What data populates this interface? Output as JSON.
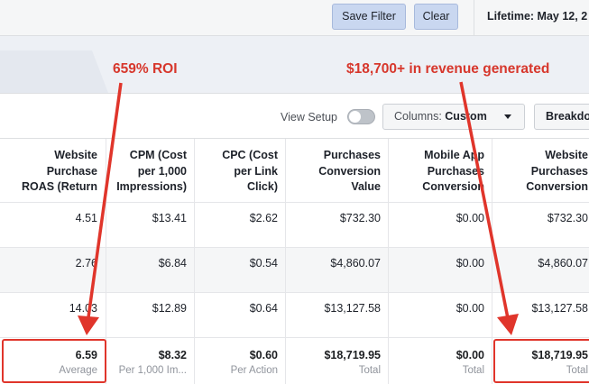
{
  "topbar": {
    "save_filter": "Save Filter",
    "clear": "Clear",
    "lifetime": "Lifetime: May 12, 2"
  },
  "annotations": {
    "roi": "659% ROI",
    "revenue": "$18,700+ in revenue generated",
    "color": "#d7372c"
  },
  "toolbar": {
    "view_setup": "View Setup",
    "columns_prefix": "Columns: ",
    "columns_value": "Custom",
    "breakdown": "Breakdo"
  },
  "table": {
    "headers": [
      [
        "Website",
        "Purchase",
        "ROAS (Return"
      ],
      [
        "CPM (Cost",
        "per 1,000",
        "Impressions)"
      ],
      [
        "CPC (Cost",
        "per Link",
        "Click)"
      ],
      [
        "Purchases",
        "Conversion",
        "Value"
      ],
      [
        "Mobile App",
        "Purchases",
        "Conversion"
      ],
      [
        "Website",
        "Purchases",
        "Conversion"
      ]
    ],
    "rows": [
      [
        "4.51",
        "$13.41",
        "$2.62",
        "$732.30",
        "$0.00",
        "$732.30"
      ],
      [
        "2.76",
        "$6.84",
        "$0.54",
        "$4,860.07",
        "$0.00",
        "$4,860.07"
      ],
      [
        "14.03",
        "$12.89",
        "$0.64",
        "$13,127.58",
        "$0.00",
        "$13,127.58"
      ]
    ],
    "totals": [
      {
        "value": "6.59",
        "label": "Average"
      },
      {
        "value": "$8.32",
        "label": "Per 1,000 Im..."
      },
      {
        "value": "$0.60",
        "label": "Per Action"
      },
      {
        "value": "$18,719.95",
        "label": "Total"
      },
      {
        "value": "$0.00",
        "label": "Total"
      },
      {
        "value": "$18,719.95",
        "label": "Total"
      }
    ]
  }
}
